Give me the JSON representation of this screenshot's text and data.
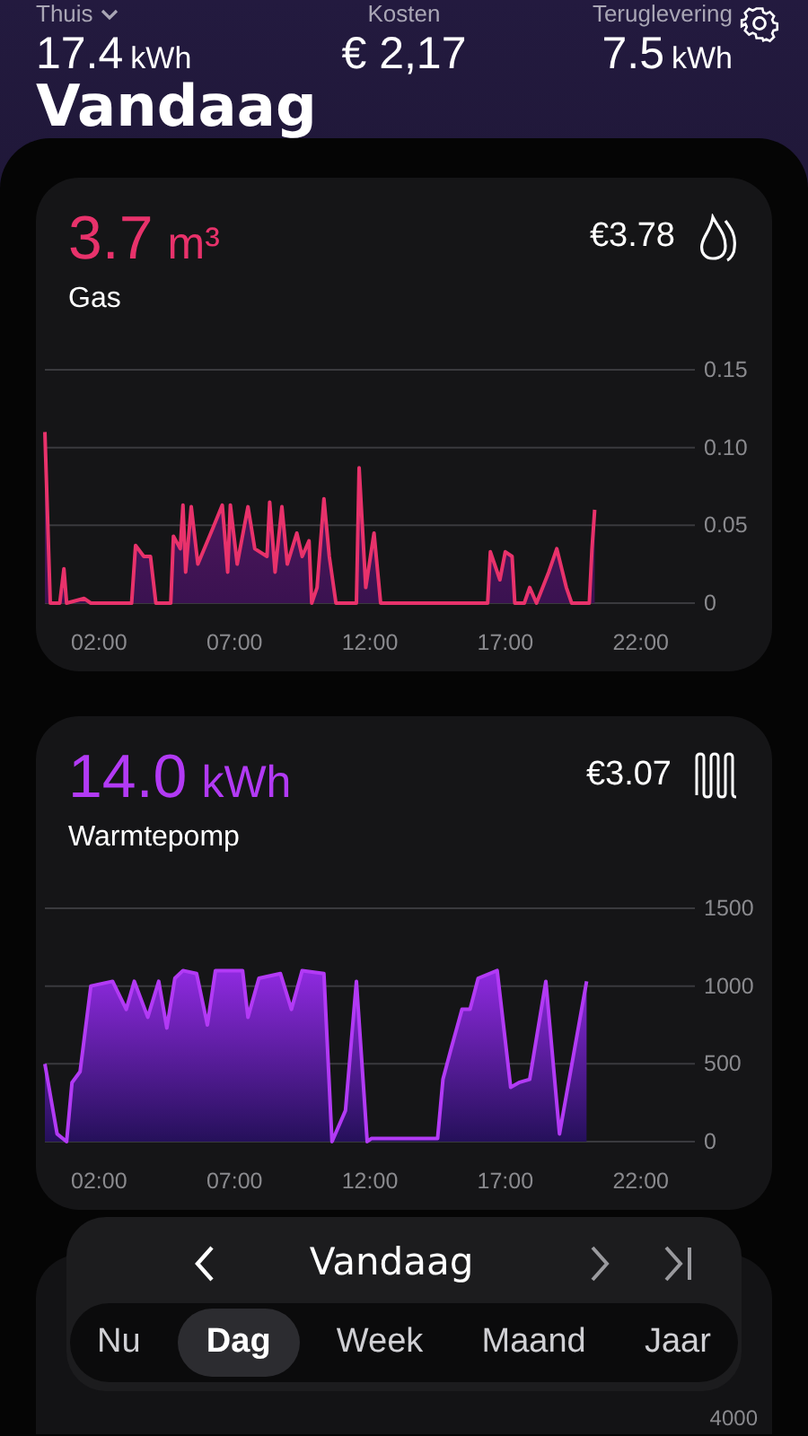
{
  "header": {
    "stats": [
      {
        "label": "Thuis",
        "dropdown": true,
        "value": "17.4",
        "unit": "kWh"
      },
      {
        "label": "Kosten",
        "dropdown": false,
        "value": "€ 2,17"
      },
      {
        "label": "Teruglevering",
        "dropdown": false,
        "value": "7.5",
        "unit": "kWh"
      }
    ],
    "title": "Vandaag"
  },
  "cards": [
    {
      "kind": "gas",
      "value": "3.7",
      "unit": "m³",
      "color": "#e8326b",
      "name": "Gas",
      "cost": "€3.78",
      "chart_data": {
        "type": "area",
        "xlim": [
          0,
          24
        ],
        "ylim": [
          0,
          0.15
        ],
        "xticks": [
          {
            "value": 2,
            "label": "02:00"
          },
          {
            "value": 7,
            "label": "07:00"
          },
          {
            "value": 12,
            "label": "12:00"
          },
          {
            "value": 17,
            "label": "17:00"
          },
          {
            "value": 22,
            "label": "22:00"
          }
        ],
        "yticks": [
          {
            "value": 0,
            "label": "0"
          },
          {
            "value": 0.05,
            "label": "0.05"
          },
          {
            "value": 0.1,
            "label": "0.10"
          },
          {
            "value": 0.15,
            "label": "0.15"
          }
        ],
        "x": [
          0,
          0.2,
          0.55,
          0.7,
          0.8,
          1.45,
          1.7,
          3.2,
          3.35,
          3.65,
          3.9,
          4.1,
          4.65,
          4.75,
          5.0,
          5.1,
          5.2,
          5.4,
          5.65,
          6.2,
          6.55,
          6.75,
          6.85,
          7.1,
          7.5,
          7.75,
          8.2,
          8.3,
          8.5,
          8.75,
          8.95,
          9.3,
          9.5,
          9.75,
          9.85,
          10.05,
          10.3,
          10.5,
          10.75,
          11.5,
          11.6,
          11.85,
          12.15,
          12.4,
          16.35,
          16.45,
          16.8,
          17.0,
          17.25,
          17.35,
          17.7,
          17.9,
          18.15,
          18.6,
          18.9,
          19.25,
          19.45,
          20.1,
          20.2,
          20.3
        ],
        "series": [
          {
            "color": "#e8326b",
            "values": [
              0.11,
              0,
              0,
              0.022,
              0,
              0.003,
              0,
              0,
              0.037,
              0.03,
              0.03,
              0,
              0,
              0.043,
              0.035,
              0.063,
              0.02,
              0.062,
              0.025,
              0.048,
              0.063,
              0.02,
              0.063,
              0.025,
              0.062,
              0.035,
              0.03,
              0.065,
              0.02,
              0.062,
              0.025,
              0.045,
              0.03,
              0.04,
              0,
              0.01,
              0.067,
              0.03,
              0,
              0,
              0.087,
              0.01,
              0.045,
              0,
              0,
              0.033,
              0.015,
              0.033,
              0.03,
              0,
              0,
              0.01,
              0,
              0.02,
              0.035,
              0.01,
              0,
              0,
              0.035,
              0.06
            ]
          }
        ]
      }
    },
    {
      "kind": "heatpump",
      "value": "14.0",
      "unit": "kWh",
      "color": "#b23af5",
      "name": "Warmtepomp",
      "cost": "€3.07",
      "chart_data": {
        "type": "area",
        "xlim": [
          0,
          24
        ],
        "ylim": [
          0,
          1500
        ],
        "xticks": [
          {
            "value": 2,
            "label": "02:00"
          },
          {
            "value": 7,
            "label": "07:00"
          },
          {
            "value": 12,
            "label": "12:00"
          },
          {
            "value": 17,
            "label": "17:00"
          },
          {
            "value": 22,
            "label": "22:00"
          }
        ],
        "yticks": [
          {
            "value": 0,
            "label": "0"
          },
          {
            "value": 500,
            "label": "500"
          },
          {
            "value": 1000,
            "label": "1000"
          },
          {
            "value": 1500,
            "label": "1500"
          }
        ],
        "x": [
          0,
          0.45,
          0.8,
          1.0,
          1.3,
          1.7,
          2.5,
          3.0,
          3.3,
          3.8,
          4.2,
          4.5,
          4.8,
          5.1,
          5.6,
          6.0,
          6.3,
          7.3,
          7.5,
          7.9,
          8.7,
          9.1,
          9.5,
          10.3,
          10.6,
          11.1,
          11.5,
          11.9,
          12.05,
          14.5,
          14.7,
          15.0,
          15.4,
          15.7,
          16.0,
          16.7,
          17.2,
          17.5,
          17.9,
          18.5,
          19.0,
          20.0
        ],
        "series": [
          {
            "color": "#b23af5",
            "values": [
              500,
              50,
              0,
              380,
              450,
              1000,
              1030,
              850,
              1030,
              800,
              1030,
              730,
              1050,
              1100,
              1080,
              750,
              1100,
              1100,
              800,
              1050,
              1080,
              850,
              1100,
              1080,
              0,
              200,
              1030,
              0,
              20,
              20,
              400,
              600,
              850,
              850,
              1050,
              1100,
              350,
              380,
              400,
              1030,
              50,
              1030
            ]
          }
        ]
      }
    }
  ],
  "partial_card": {
    "tick": "4000"
  },
  "period_nav": {
    "title": "Vandaag",
    "tabs": [
      {
        "label": "Nu",
        "selected": false
      },
      {
        "label": "Dag",
        "selected": true
      },
      {
        "label": "Week",
        "selected": false
      },
      {
        "label": "Maand",
        "selected": false
      },
      {
        "label": "Jaar",
        "selected": false
      }
    ]
  }
}
